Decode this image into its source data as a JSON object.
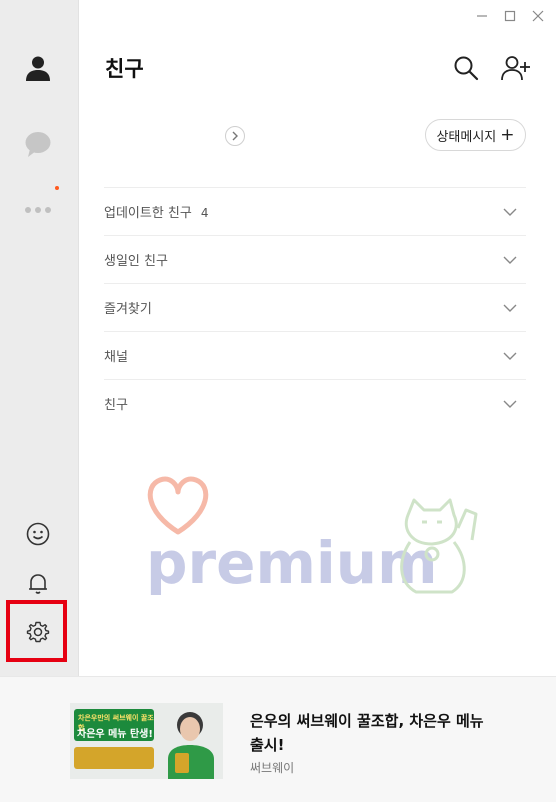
{
  "window": {
    "minimize_icon": "minimize-icon",
    "maximize_icon": "maximize-icon",
    "close_icon": "close-icon"
  },
  "sidebar": {
    "items": [
      {
        "name": "friends",
        "icon": "person-icon",
        "active": true
      },
      {
        "name": "chats",
        "icon": "chat-bubble-icon",
        "active": false
      },
      {
        "name": "more",
        "icon": "more-dots-icon",
        "active": false,
        "has_notification": true
      }
    ],
    "bottom": [
      {
        "name": "emoticon",
        "icon": "smiley-icon"
      },
      {
        "name": "notifications",
        "icon": "bell-icon"
      },
      {
        "name": "settings",
        "icon": "gear-icon",
        "highlighted": true
      }
    ],
    "highlight_color": "#e60012",
    "notification_color": "#ff5a1f"
  },
  "header": {
    "title": "친구",
    "search_icon": "search-icon",
    "add_friend_icon": "add-friend-icon"
  },
  "status": {
    "label": "상태메시지",
    "plus": "+"
  },
  "sections": [
    {
      "label": "업데이트한 친구",
      "count": "4"
    },
    {
      "label": "생일인 친구",
      "count": ""
    },
    {
      "label": "즐겨찾기",
      "count": ""
    },
    {
      "label": "채널",
      "count": ""
    },
    {
      "label": "친구",
      "count": ""
    }
  ],
  "watermark": {
    "text": "premium"
  },
  "ad": {
    "image_caption_top": "차은우만의 써브웨이 꿀조합",
    "image_caption_main": "차은우 메뉴 탄생!",
    "title": "은우의 써브웨이 꿀조합, 차은우 메뉴 출시!",
    "brand": "써브웨이"
  }
}
